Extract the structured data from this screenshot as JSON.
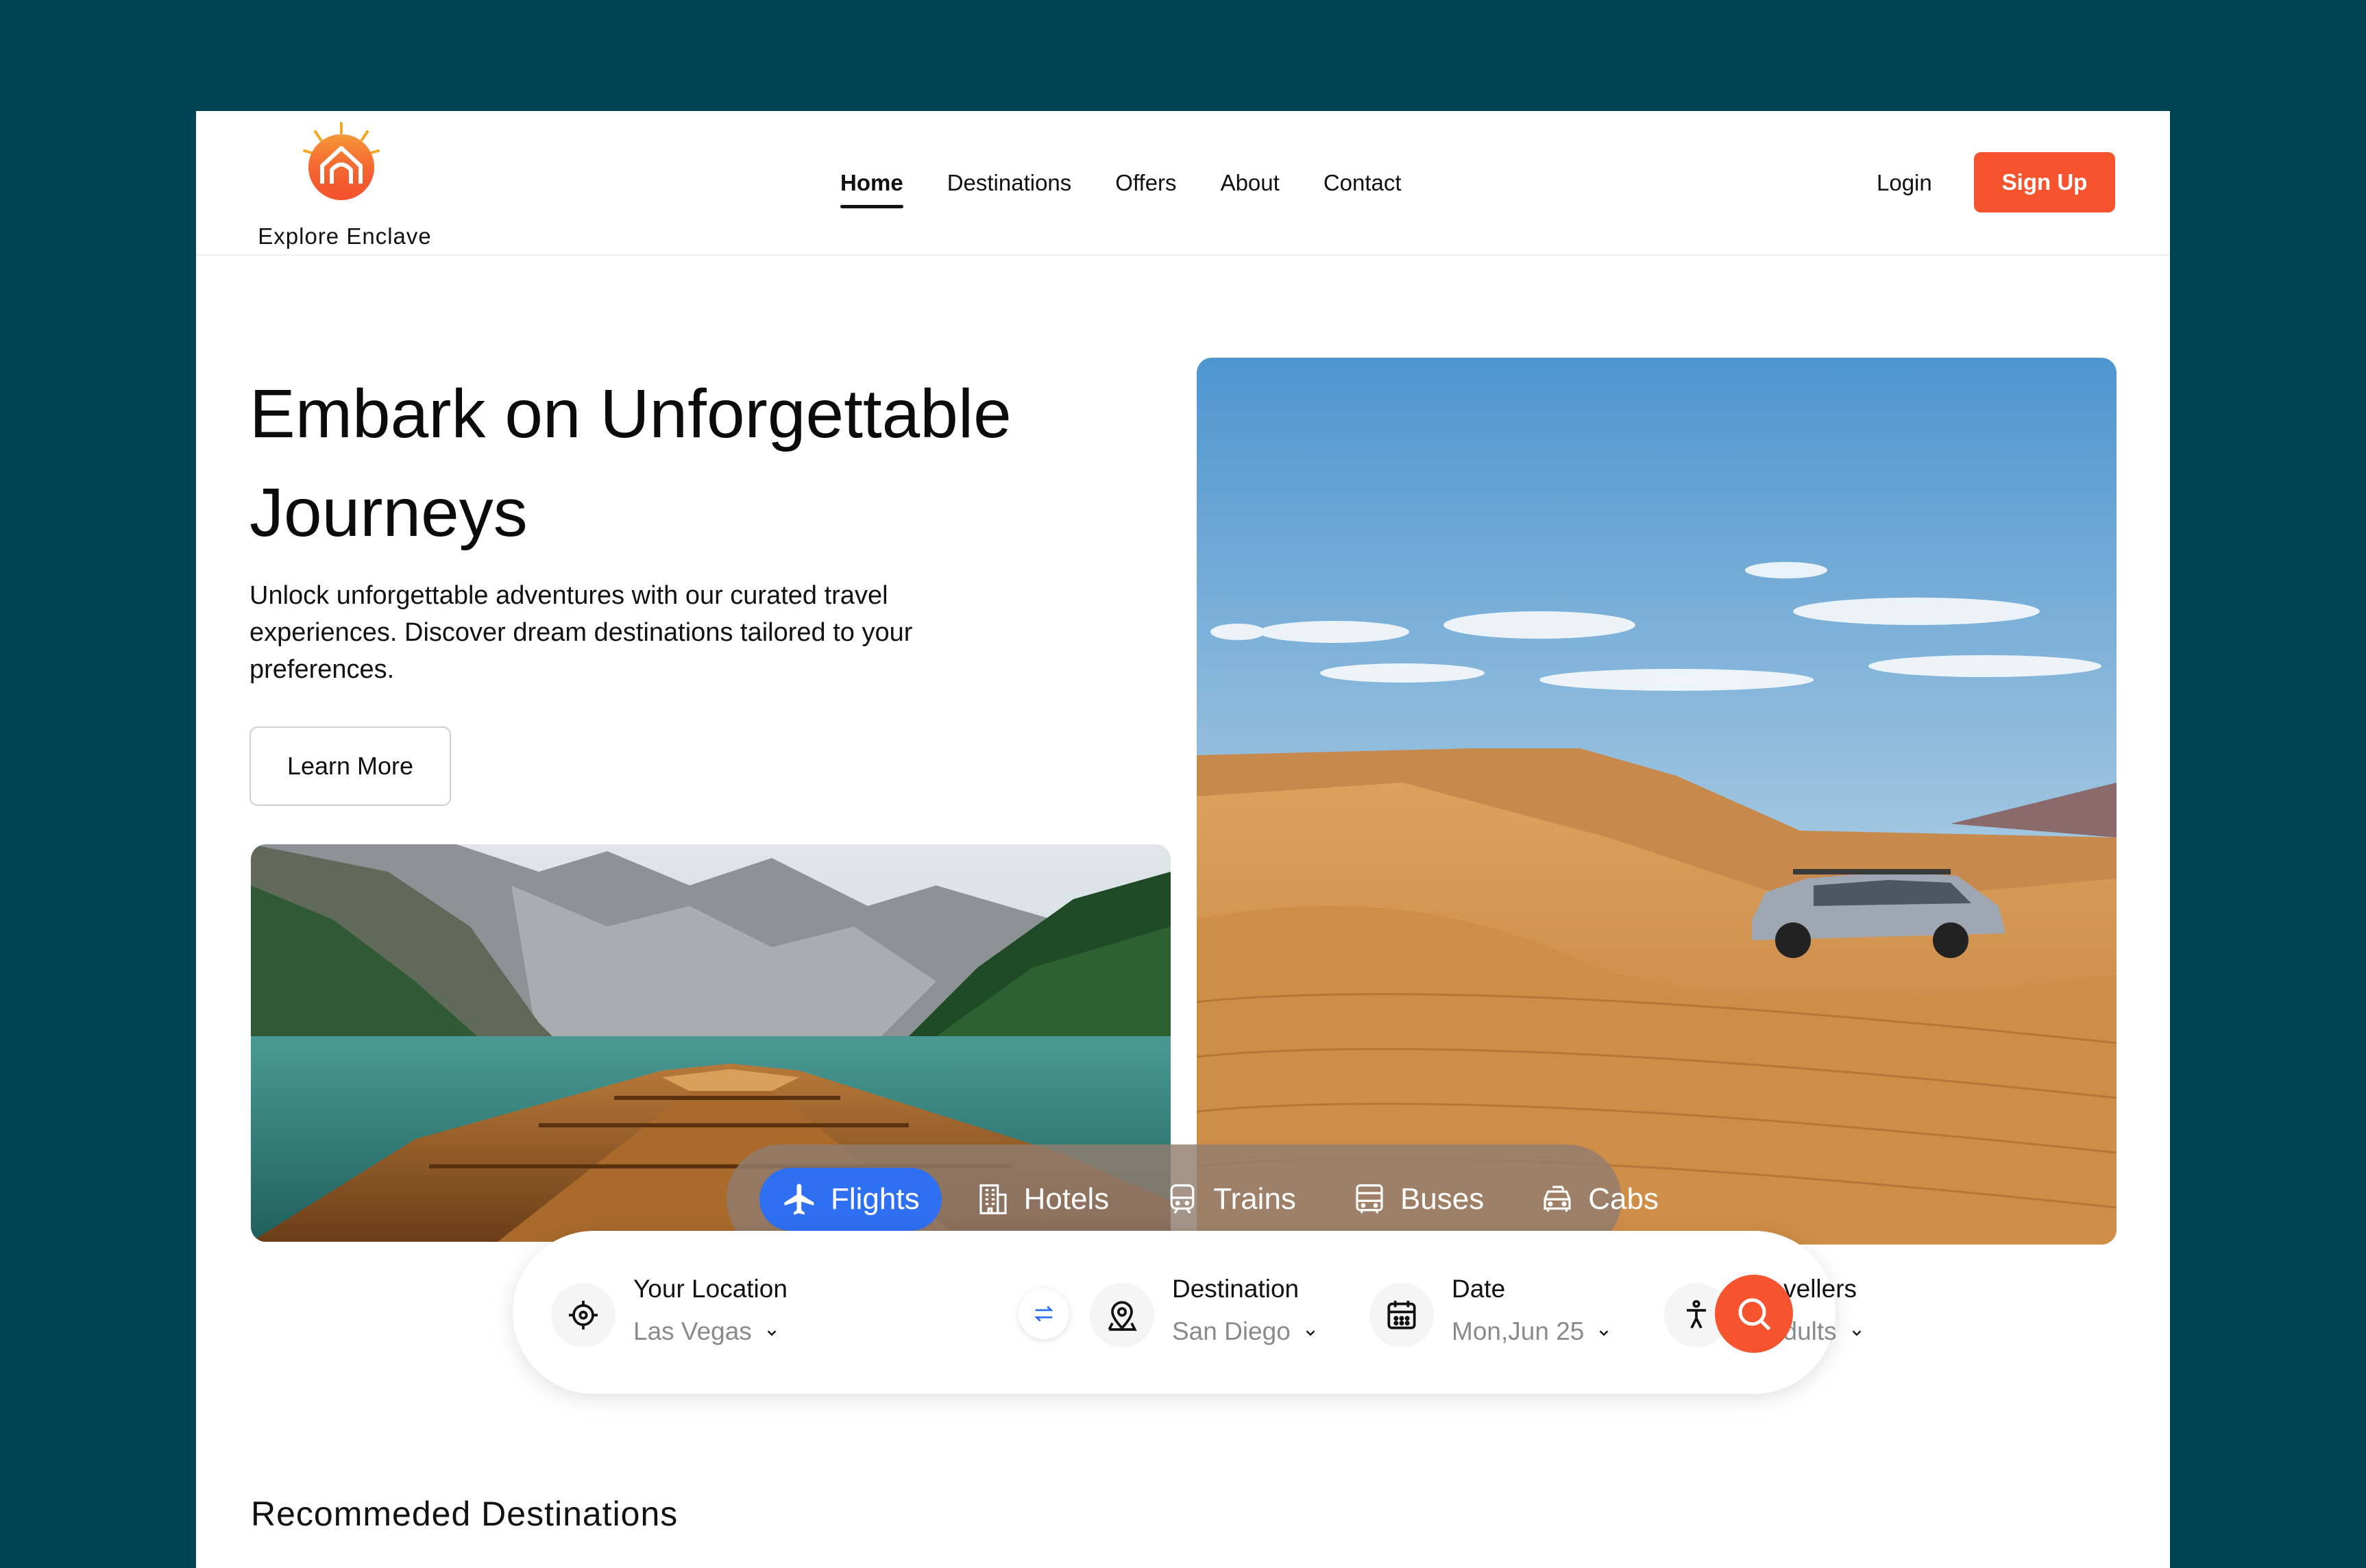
{
  "brand": {
    "name": "Explore Enclave",
    "accent": "#f5542f",
    "primary_blue": "#2f6ff2",
    "background": "#004354"
  },
  "nav": {
    "items": [
      {
        "label": "Home",
        "active": true
      },
      {
        "label": "Destinations"
      },
      {
        "label": "Offers"
      },
      {
        "label": "About"
      },
      {
        "label": "Contact"
      }
    ],
    "login": "Login",
    "signup": "Sign Up"
  },
  "hero": {
    "title": "Embark on Unforgettable Journeys",
    "subtitle": "Unlock unforgettable adventures with our curated travel experiences. Discover dream destinations tailored to your preferences.",
    "cta": "Learn More"
  },
  "tabs": [
    {
      "label": "Flights",
      "icon": "airplane-icon",
      "active": true
    },
    {
      "label": "Hotels",
      "icon": "building-icon"
    },
    {
      "label": "Trains",
      "icon": "train-icon"
    },
    {
      "label": "Buses",
      "icon": "bus-icon"
    },
    {
      "label": "Cabs",
      "icon": "car-icon"
    }
  ],
  "search": {
    "location": {
      "label": "Your Location",
      "value": "Las Vegas"
    },
    "destination": {
      "label": "Destination",
      "value": "San Diego"
    },
    "date": {
      "label": "Date",
      "value": "Mon,Jun 25"
    },
    "travellers": {
      "label": "Travellers",
      "value": "2 Adults"
    }
  },
  "recommended": {
    "title": "Recommeded Destinations"
  }
}
